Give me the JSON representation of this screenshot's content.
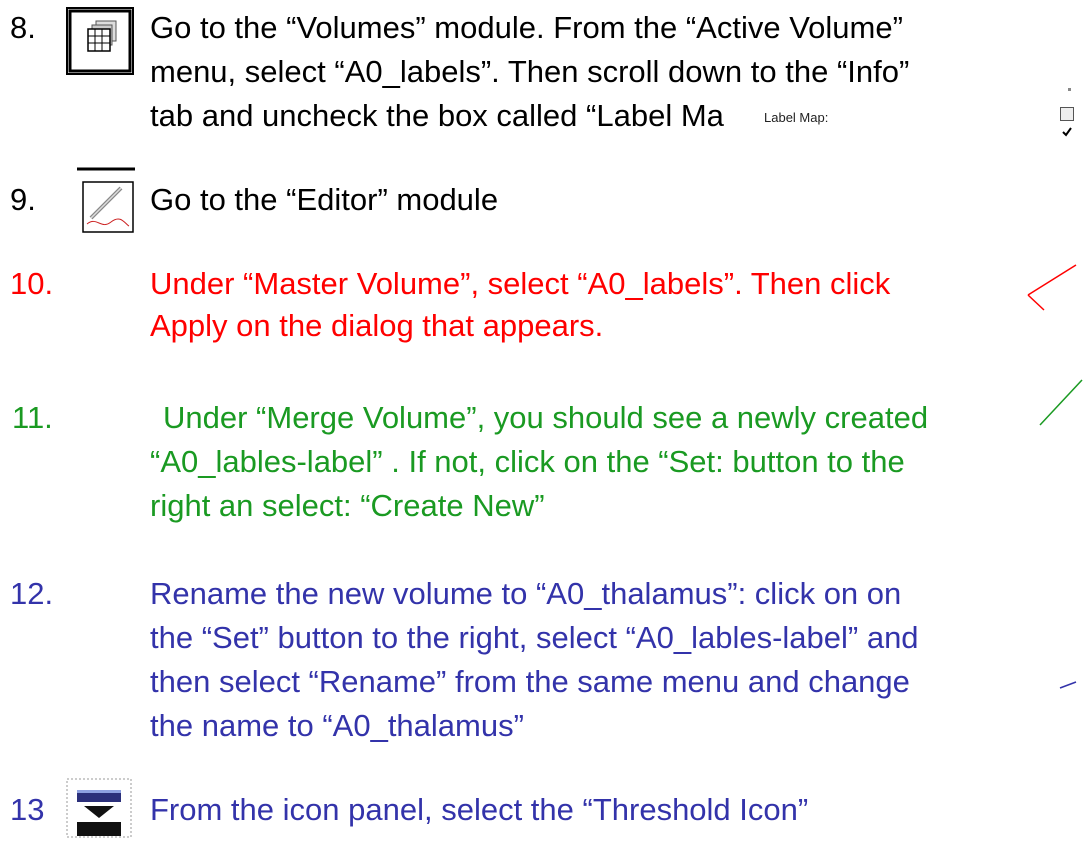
{
  "colors": {
    "step10": "#ff0000",
    "step11": "#1a9a22",
    "step12": "#3333aa",
    "body": "#000000"
  },
  "steps": [
    {
      "number": "8.",
      "icon": "volumes-grid-icon",
      "lines": [
        "Go to the “Volumes” module. From the “Active Volume”",
        "menu, select “A0_labels”. Then scroll down to the “Info”",
        "tab and uncheck the box called “Label Ma"
      ],
      "inset_label": "Label Map:"
    },
    {
      "number": "9.",
      "icon": "editor-pencil-icon",
      "lines": [
        "Go to the “Editor” module"
      ]
    },
    {
      "number": "10.",
      "lines": [
        "Under “Master Volume”, select “A0_labels”. Then click",
        "Apply on the dialog that appears."
      ]
    },
    {
      "number": "11.",
      "lines": [
        "Under “Merge Volume”, you should see a newly created",
        "“A0_lables-label” . If not, click on the “Set: button to the",
        "right an select: “Create New”"
      ]
    },
    {
      "number": "12.",
      "lines": [
        "Rename the new volume to “A0_thalamus”: click on on",
        "the “Set” button to the right, select “A0_lables-label”  and",
        "then select “Rename” from the same menu and change",
        "the name to  “A0_thalamus”"
      ]
    },
    {
      "number": "13",
      "icon": "threshold-icon",
      "lines": [
        "From the icon panel, select the “Threshold Icon”"
      ]
    }
  ]
}
